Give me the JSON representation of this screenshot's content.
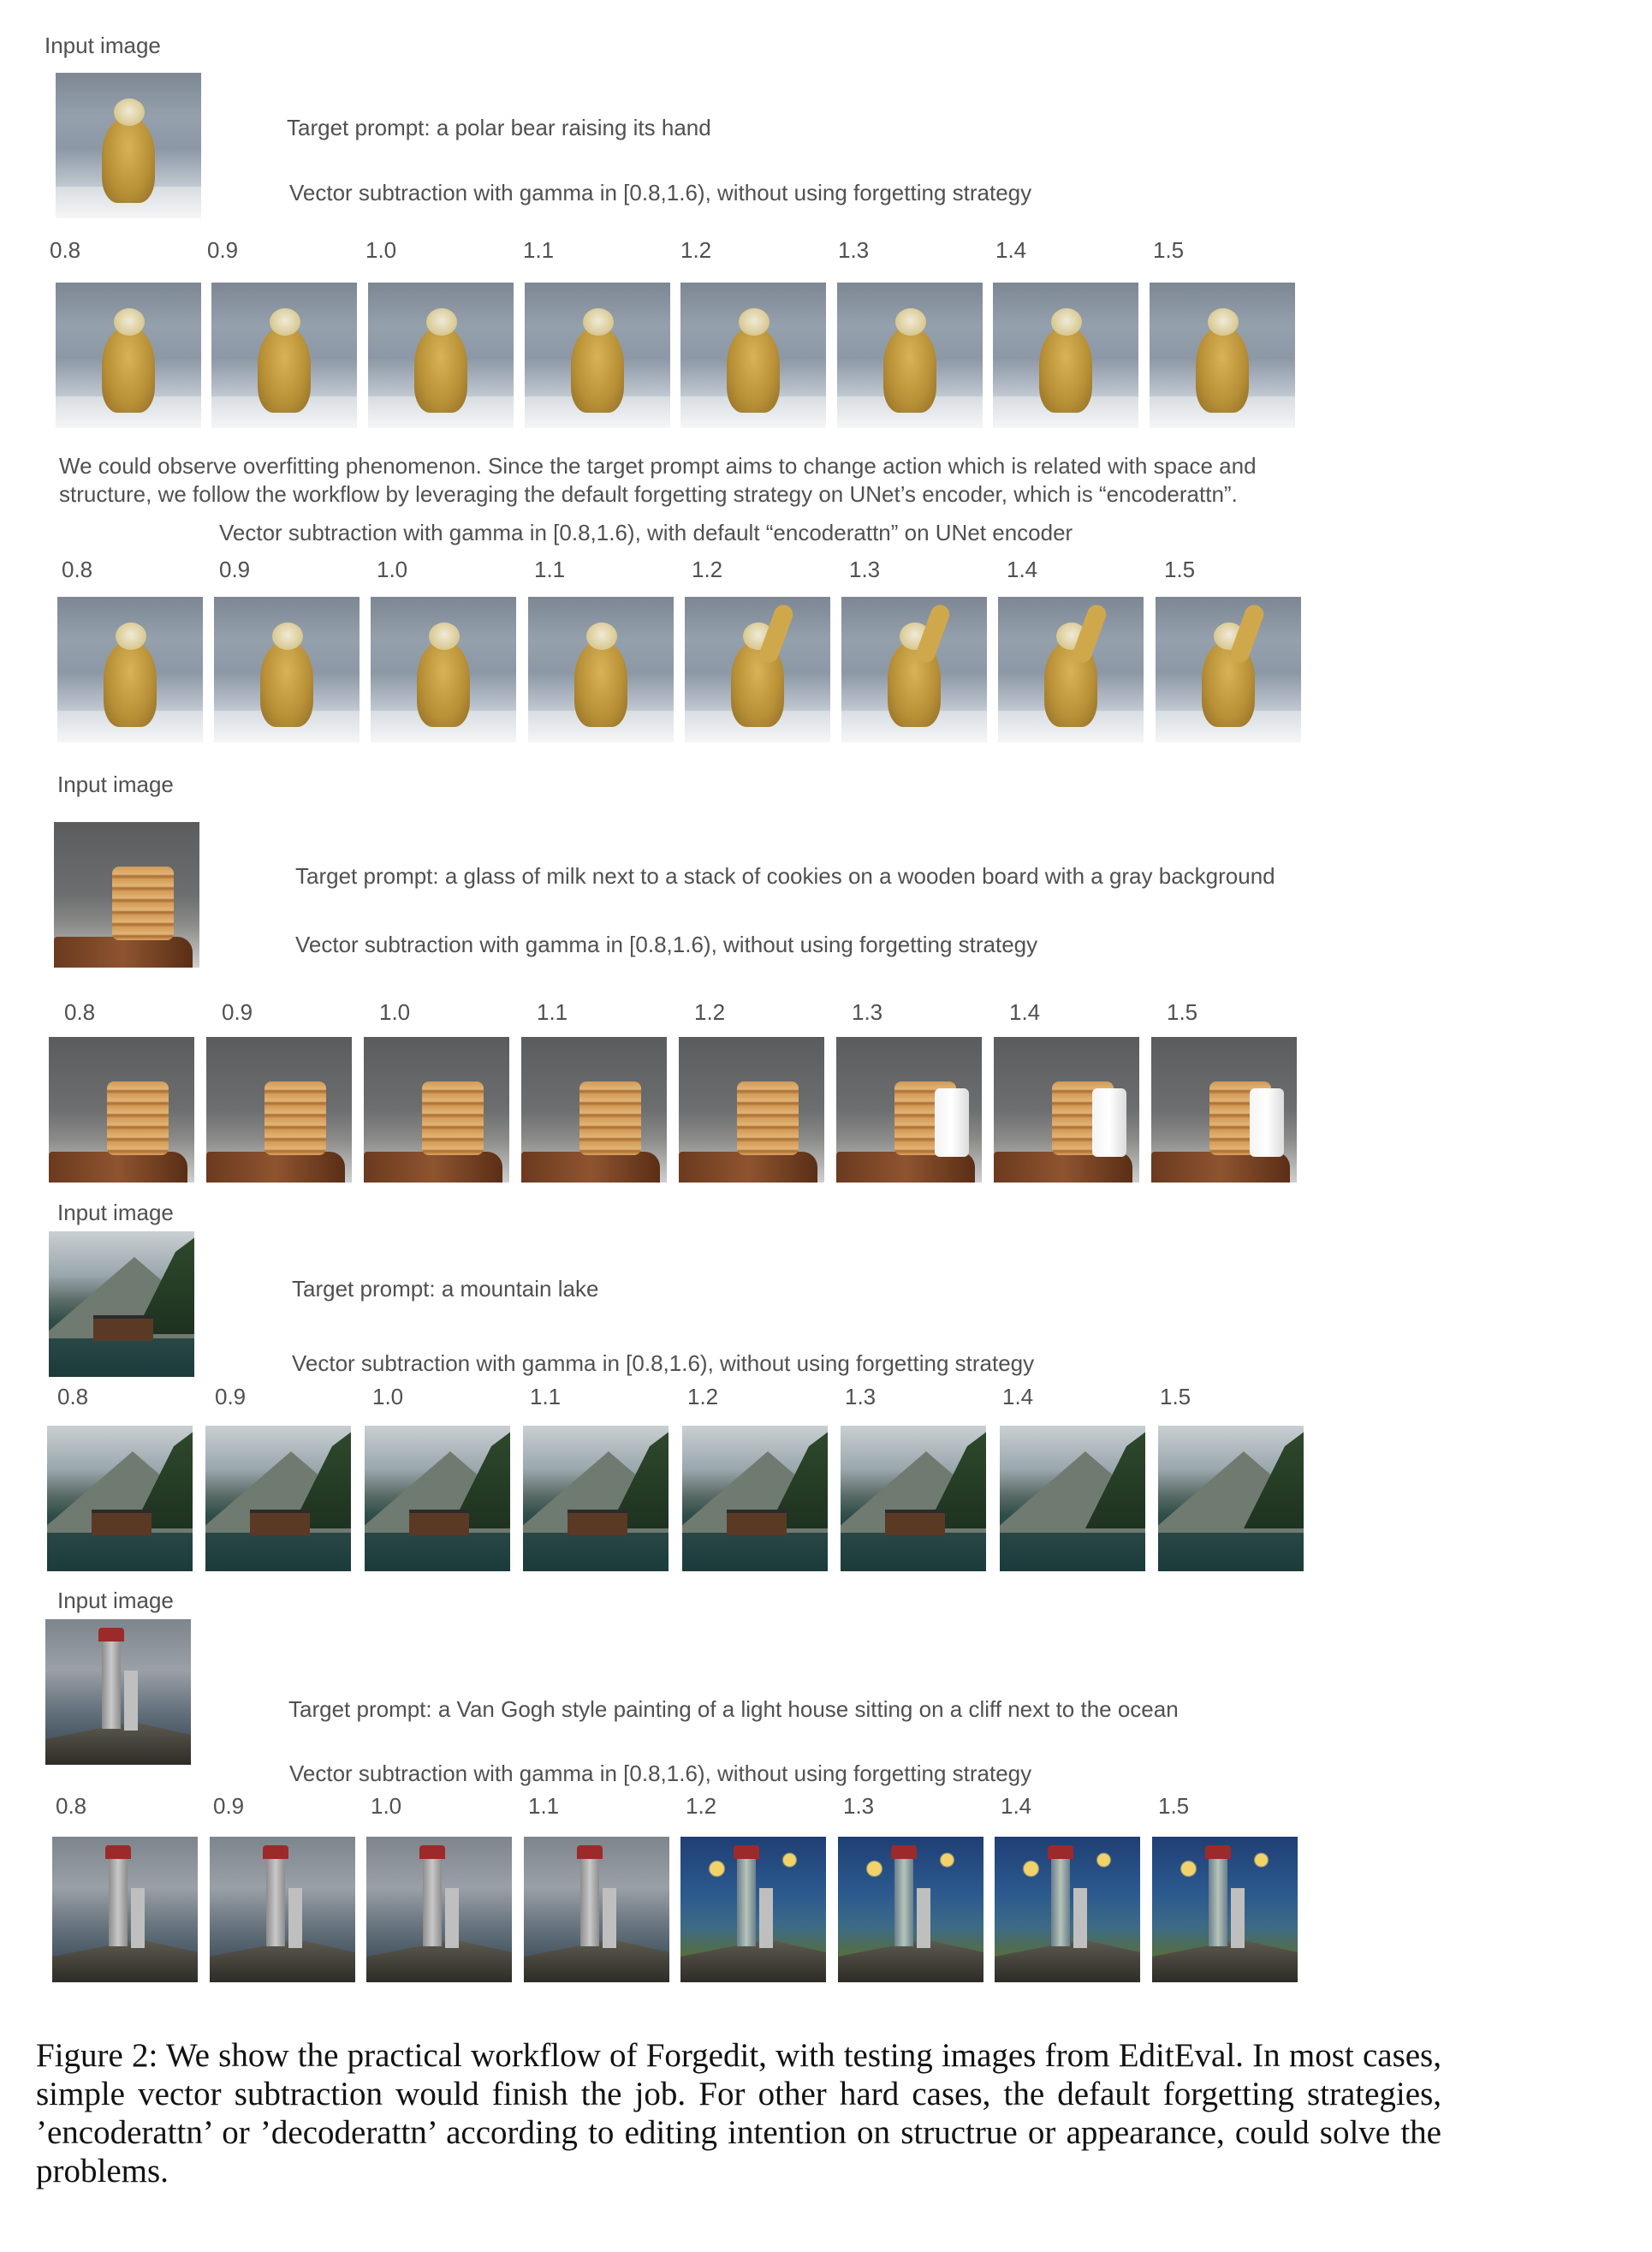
{
  "input_label": "Input image",
  "gammas": [
    "0.8",
    "0.9",
    "1.0",
    "1.1",
    "1.2",
    "1.3",
    "1.4",
    "1.5"
  ],
  "bear": {
    "target_prompt": "Target prompt: a polar bear raising its hand",
    "vector_no_forget": "Vector subtraction with gamma in [0.8,1.6), without using forgetting strategy",
    "note_line1": "We could observe overfitting phenomenon. Since the target prompt aims to change action which is related with space and",
    "note_line2": "structure,  we follow the workflow by leveraging the  default forgetting strategy on UNet’s encoder, which is “encoderattn”.",
    "vector_encoderattn": "Vector subtraction with gamma in [0.8,1.6), with default “encoderattn” on UNet encoder"
  },
  "cookies": {
    "target_prompt": "Target prompt: a glass of milk next to a stack of cookies on a wooden board with a gray background",
    "vector_no_forget": "Vector subtraction with gamma in [0.8,1.6), without using forgetting strategy"
  },
  "lake": {
    "target_prompt": "Target prompt: a mountain lake",
    "vector_no_forget": "Vector subtraction with gamma in [0.8,1.6), without using forgetting strategy"
  },
  "lighthouse": {
    "target_prompt": "Target prompt: a Van Gogh style painting of a light house sitting on a cliff next to the ocean",
    "vector_no_forget": "Vector subtraction with gamma in [0.8,1.6), without using forgetting strategy"
  },
  "caption": "Figure 2: We show the practical workflow of Forgedit, with testing images from EditEval. In most cases, simple vector subtraction would finish the job. For other hard cases, the default forgetting strategies, ’encoderattn’ or ’decoderattn’ according to editing intention on structrue or appearance, could solve the problems."
}
